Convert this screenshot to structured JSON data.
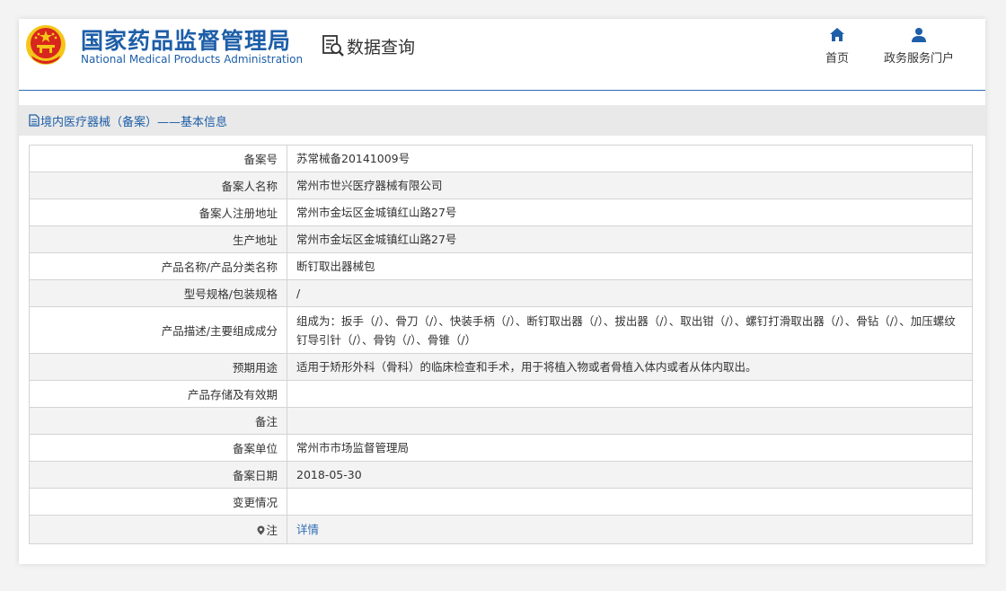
{
  "header": {
    "org_name_cn": "国家药品监督管理局",
    "org_name_en": "National Medical Products Administration",
    "query_label": "数据查询",
    "nav": {
      "home": "首页",
      "portal": "政务服务门户"
    }
  },
  "section": {
    "title": "境内医疗器械（备案）——基本信息"
  },
  "rows": [
    {
      "label": "备案号",
      "value": "苏常械备20141009号"
    },
    {
      "label": "备案人名称",
      "value": "常州市世兴医疗器械有限公司"
    },
    {
      "label": "备案人注册地址",
      "value": "常州市金坛区金城镇红山路27号"
    },
    {
      "label": "生产地址",
      "value": "常州市金坛区金城镇红山路27号"
    },
    {
      "label": "产品名称/产品分类名称",
      "value": "断钉取出器械包"
    },
    {
      "label": "型号规格/包装规格",
      "value": "/"
    },
    {
      "label": "产品描述/主要组成成分",
      "value": "组成为：扳手（/）、骨刀（/）、快装手柄（/）、断钉取出器（/）、拔出器（/）、取出钳（/）、螺钉打滑取出器（/）、骨钻（/）、加压螺纹钉导引针（/）、骨钩（/）、骨锥（/）"
    },
    {
      "label": "预期用途",
      "value": "适用于矫形外科（骨科）的临床检查和手术，用于将植入物或者骨植入体内或者从体内取出。"
    },
    {
      "label": "产品存储及有效期",
      "value": ""
    },
    {
      "label": "备注",
      "value": ""
    },
    {
      "label": "备案单位",
      "value": "常州市市场监督管理局"
    },
    {
      "label": "备案日期",
      "value": "2018-05-30"
    },
    {
      "label": "变更情况",
      "value": ""
    },
    {
      "label": "注",
      "value": "详情"
    }
  ],
  "colors": {
    "brand_blue": "#1d5ea8",
    "link_blue": "#2e6db5",
    "emblem_red": "#d7261e",
    "emblem_gold": "#f5c518"
  },
  "icons": [
    "national-emblem-icon",
    "data-query-icon",
    "home-icon",
    "user-icon",
    "document-icon",
    "location-pin-icon"
  ]
}
